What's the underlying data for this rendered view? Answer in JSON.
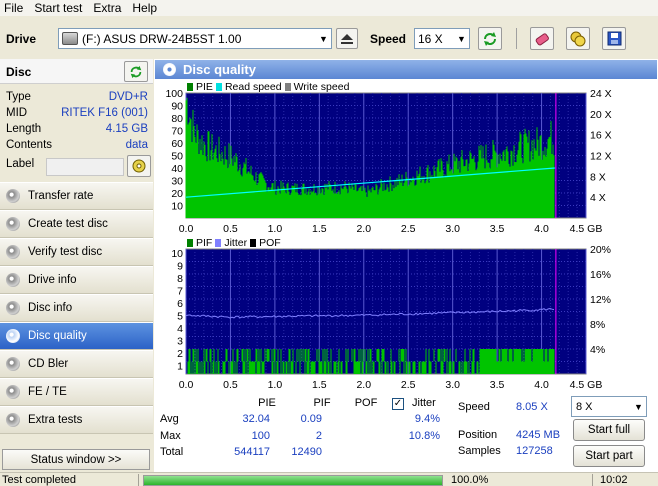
{
  "menu": [
    "File",
    "Start test",
    "Extra",
    "Help"
  ],
  "drive": {
    "label": "Drive",
    "selected": "(F:)  ASUS DRW-24B5ST 1.00",
    "speed_label": "Speed",
    "speed_value": "16 X"
  },
  "disc": {
    "title": "Disc",
    "rows": [
      {
        "key": "Type",
        "value": "DVD+R"
      },
      {
        "key": "MID",
        "value": "RITEK F16 (001)"
      },
      {
        "key": "Length",
        "value": "4.15 GB"
      },
      {
        "key": "Contents",
        "value": "data"
      }
    ],
    "label_key": "Label"
  },
  "nav": [
    {
      "label": "Transfer rate",
      "active": false
    },
    {
      "label": "Create test disc",
      "active": false
    },
    {
      "label": "Verify test disc",
      "active": false
    },
    {
      "label": "Drive info",
      "active": false
    },
    {
      "label": "Disc info",
      "active": false
    },
    {
      "label": "Disc quality",
      "active": true
    },
    {
      "label": "CD Bler",
      "active": false
    },
    {
      "label": "FE / TE",
      "active": false
    },
    {
      "label": "Extra tests",
      "active": false
    }
  ],
  "status_window_button": "Status window >>",
  "panel_title": "Disc quality",
  "colors": {
    "pie": "#00c400",
    "read": "#00ffff",
    "write": "#808080",
    "plot_bg": "#000080",
    "pif": "#00c400",
    "jitter": "#8080ff",
    "pof": "#000000",
    "marker": "#ff00ff"
  },
  "chart_data": [
    {
      "type": "area",
      "legend": [
        "PIE",
        "Read speed",
        "Write speed"
      ],
      "x_ticks": [
        "0.0",
        "0.5",
        "1.0",
        "1.5",
        "2.0",
        "2.5",
        "3.0",
        "3.5",
        "4.0",
        "4.5 GB"
      ],
      "y_ticks_left": [
        "100",
        "90",
        "80",
        "70",
        "60",
        "50",
        "40",
        "30",
        "20",
        "10"
      ],
      "y_ticks_right": [
        "24 X",
        "20 X",
        "16 X",
        "12 X",
        "8 X",
        "4 X"
      ],
      "xlim": [
        0,
        4.5
      ],
      "ylim": [
        0,
        100
      ],
      "y2lim": [
        0,
        24
      ],
      "series": [
        {
          "name": "PIE",
          "x": [
            0.0,
            0.02,
            0.05,
            0.1,
            0.2,
            0.3,
            0.4,
            0.5,
            0.6,
            0.7,
            0.8,
            0.9,
            1.0,
            1.2,
            1.4,
            1.6,
            1.8,
            1.9,
            2.0,
            2.1,
            2.2,
            2.4,
            2.6,
            2.8,
            3.0,
            3.2,
            3.4,
            3.6,
            3.8,
            4.0,
            4.1,
            4.15
          ],
          "y": [
            100,
            98,
            85,
            72,
            63,
            58,
            55,
            52,
            47,
            40,
            34,
            29,
            26,
            25,
            25,
            26,
            26,
            24,
            22,
            23,
            27,
            31,
            36,
            40,
            45,
            49,
            53,
            56,
            61,
            64,
            68,
            66
          ]
        },
        {
          "name": "Read speed",
          "x": [
            0.0,
            4.15
          ],
          "y": [
            4.0,
            9.6
          ]
        }
      ]
    },
    {
      "type": "bar",
      "legend": [
        "PIF",
        "Jitter",
        "POF"
      ],
      "x_ticks": [
        "0.0",
        "0.5",
        "1.0",
        "1.5",
        "2.0",
        "2.5",
        "3.0",
        "3.5",
        "4.0",
        "4.5 GB"
      ],
      "y_ticks_left": [
        "10",
        "9",
        "8",
        "7",
        "6",
        "5",
        "4",
        "3",
        "2",
        "1"
      ],
      "y_ticks_right": [
        "20%",
        "16%",
        "12%",
        "8%",
        "4%"
      ],
      "xlim": [
        0,
        4.5
      ],
      "ylim": [
        0,
        10
      ],
      "y2lim": [
        0,
        20
      ],
      "series": [
        {
          "name": "Jitter",
          "x": [
            0.0,
            0.5,
            1.0,
            1.5,
            2.0,
            2.5,
            3.0,
            3.5,
            4.0,
            4.15
          ],
          "y": [
            9.4,
            9.1,
            9.2,
            9.3,
            9.4,
            9.6,
            9.8,
            10.0,
            10.3,
            10.4
          ]
        },
        {
          "name": "PIF",
          "x_range": [
            0.0,
            4.15
          ],
          "y_max": 2
        }
      ]
    }
  ],
  "stats": {
    "headers": [
      "PIE",
      "PIF",
      "POF",
      "Jitter"
    ],
    "rows": [
      {
        "label": "Avg",
        "pie": "32.04",
        "pif": "0.09",
        "pof": "",
        "jitter": "9.4%"
      },
      {
        "label": "Max",
        "pie": "100",
        "pif": "2",
        "pof": "",
        "jitter": "10.8%"
      },
      {
        "label": "Total",
        "pie": "544117",
        "pif": "12490",
        "pof": "",
        "jitter": ""
      }
    ],
    "jitter_checked": true,
    "speed_label": "Speed",
    "speed_value": "8.05 X",
    "position_label": "Position",
    "position_value": "4245 MB",
    "samples_label": "Samples",
    "samples_value": "127258",
    "test_speed": "8 X",
    "start_full": "Start full",
    "start_part": "Start part"
  },
  "statusbar": {
    "text": "Test completed",
    "progress": 100,
    "progress_label": "100.0%",
    "time": "10:02"
  }
}
